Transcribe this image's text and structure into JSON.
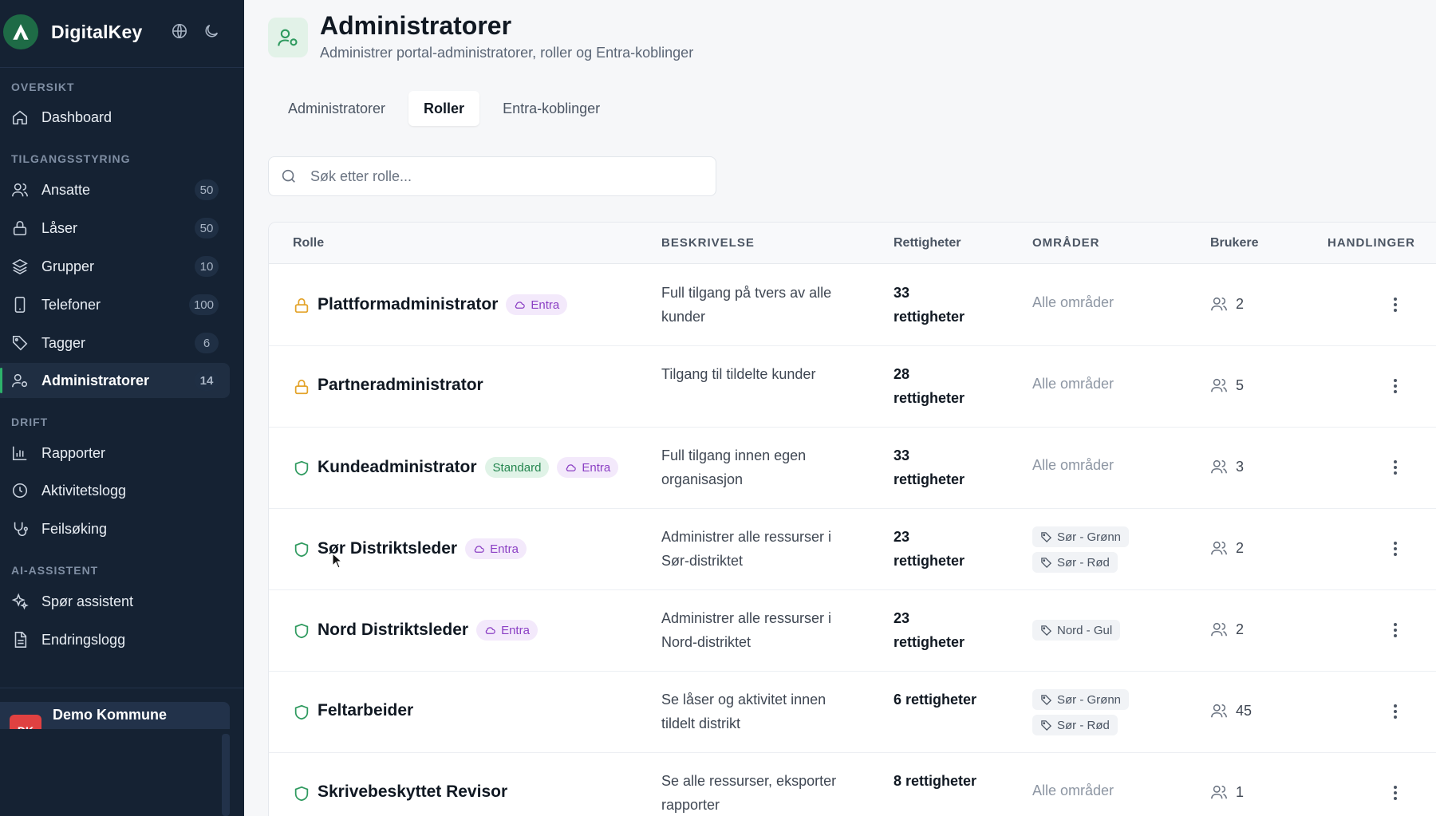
{
  "app": {
    "name": "DigitalKey"
  },
  "sidebar": {
    "sections": [
      {
        "label": "OVERSIKT"
      },
      {
        "label": "TILGANGSSTYRING"
      },
      {
        "label": "DRIFT"
      },
      {
        "label": "AI-ASSISTENT"
      }
    ],
    "items": [
      {
        "label": "Dashboard",
        "icon": "home-icon"
      },
      {
        "label": "Ansatte",
        "badge": "50",
        "icon": "users-icon"
      },
      {
        "label": "Låser",
        "badge": "50",
        "icon": "lock-icon"
      },
      {
        "label": "Grupper",
        "badge": "10",
        "icon": "layers-icon"
      },
      {
        "label": "Telefoner",
        "badge": "100",
        "icon": "phone-icon"
      },
      {
        "label": "Tagger",
        "badge": "6",
        "icon": "tag-icon"
      },
      {
        "label": "Administratorer",
        "badge": "14",
        "icon": "user-gear-icon",
        "active": true
      },
      {
        "label": "Rapporter",
        "icon": "bar-chart-icon"
      },
      {
        "label": "Aktivitetslogg",
        "icon": "clock-icon"
      },
      {
        "label": "Feilsøking",
        "icon": "stethoscope-icon"
      },
      {
        "label": "Spør assistent",
        "icon": "sparkles-icon"
      },
      {
        "label": "Endringslogg",
        "icon": "document-icon"
      }
    ],
    "organization": {
      "avatar_text": "DK",
      "name": "Demo Kommune"
    }
  },
  "header": {
    "title": "Administratorer",
    "subtitle": "Administrer portal-administratorer, roller og Entra-koblinger"
  },
  "tabs": [
    {
      "label": "Administratorer"
    },
    {
      "label": "Roller",
      "active": true
    },
    {
      "label": "Entra-koblinger"
    }
  ],
  "search": {
    "placeholder": "Søk etter rolle..."
  },
  "table": {
    "columns": {
      "role": "Rolle",
      "description": "BESKRIVELSE",
      "permissions": "Rettigheter",
      "areas": "OMRÅDER",
      "users": "Brukere",
      "actions": "HANDLINGER"
    },
    "rows": [
      {
        "name": "Plattformadministrator",
        "icon": "lock-icon",
        "badges": [
          "Entra"
        ],
        "standard": "",
        "description": "Full tilgang på tvers av alle kunder",
        "permissions": "33 rettigheter",
        "areas_text": "Alle områder",
        "area_tags": [],
        "users": "2"
      },
      {
        "name": "Partneradministrator",
        "icon": "lock-icon",
        "badges": [],
        "standard": "",
        "description": "Tilgang til tildelte kunder",
        "permissions": "28 rettigheter",
        "areas_text": "Alle områder",
        "area_tags": [],
        "users": "5"
      },
      {
        "name": "Kundeadministrator",
        "icon": "shield-icon",
        "badges": [
          "Entra"
        ],
        "standard": "Standard",
        "description": "Full tilgang innen egen organisasjon",
        "permissions": "33 rettigheter",
        "areas_text": "Alle områder",
        "area_tags": [],
        "users": "3"
      },
      {
        "name": "Sør Distriktsleder",
        "icon": "shield-icon",
        "badges": [
          "Entra"
        ],
        "standard": "",
        "description": "Administrer alle ressurser i Sør-distriktet",
        "permissions": "23 rettigheter",
        "areas_text": "",
        "area_tags": [
          "Sør - Grønn",
          "Sør - Rød"
        ],
        "users": "2"
      },
      {
        "name": "Nord Distriktsleder",
        "icon": "shield-icon",
        "badges": [
          "Entra"
        ],
        "standard": "",
        "description": "Administrer alle ressurser i Nord-distriktet",
        "permissions": "23 rettigheter",
        "areas_text": "",
        "area_tags": [
          "Nord - Gul"
        ],
        "users": "2"
      },
      {
        "name": "Feltarbeider",
        "icon": "shield-icon",
        "badges": [],
        "standard": "",
        "description": "Se låser og aktivitet innen tildelt distrikt",
        "permissions": "6 rettigheter",
        "areas_text": "",
        "area_tags": [
          "Sør - Grønn",
          "Sør - Rød"
        ],
        "users": "45"
      },
      {
        "name": "Skrivebeskyttet Revisor",
        "icon": "shield-icon",
        "badges": [],
        "standard": "",
        "description": "Se alle ressurser, eksporter rapporter",
        "permissions": "8 rettigheter",
        "areas_text": "Alle områder",
        "area_tags": [],
        "users": "1"
      }
    ]
  },
  "colors": {
    "sidebar_bg": "#152233",
    "accent_green": "#2db36b",
    "lock_amber": "#e3a32a",
    "shield_green": "#2f9a5f",
    "entra_purple": "#8b3fc4"
  }
}
